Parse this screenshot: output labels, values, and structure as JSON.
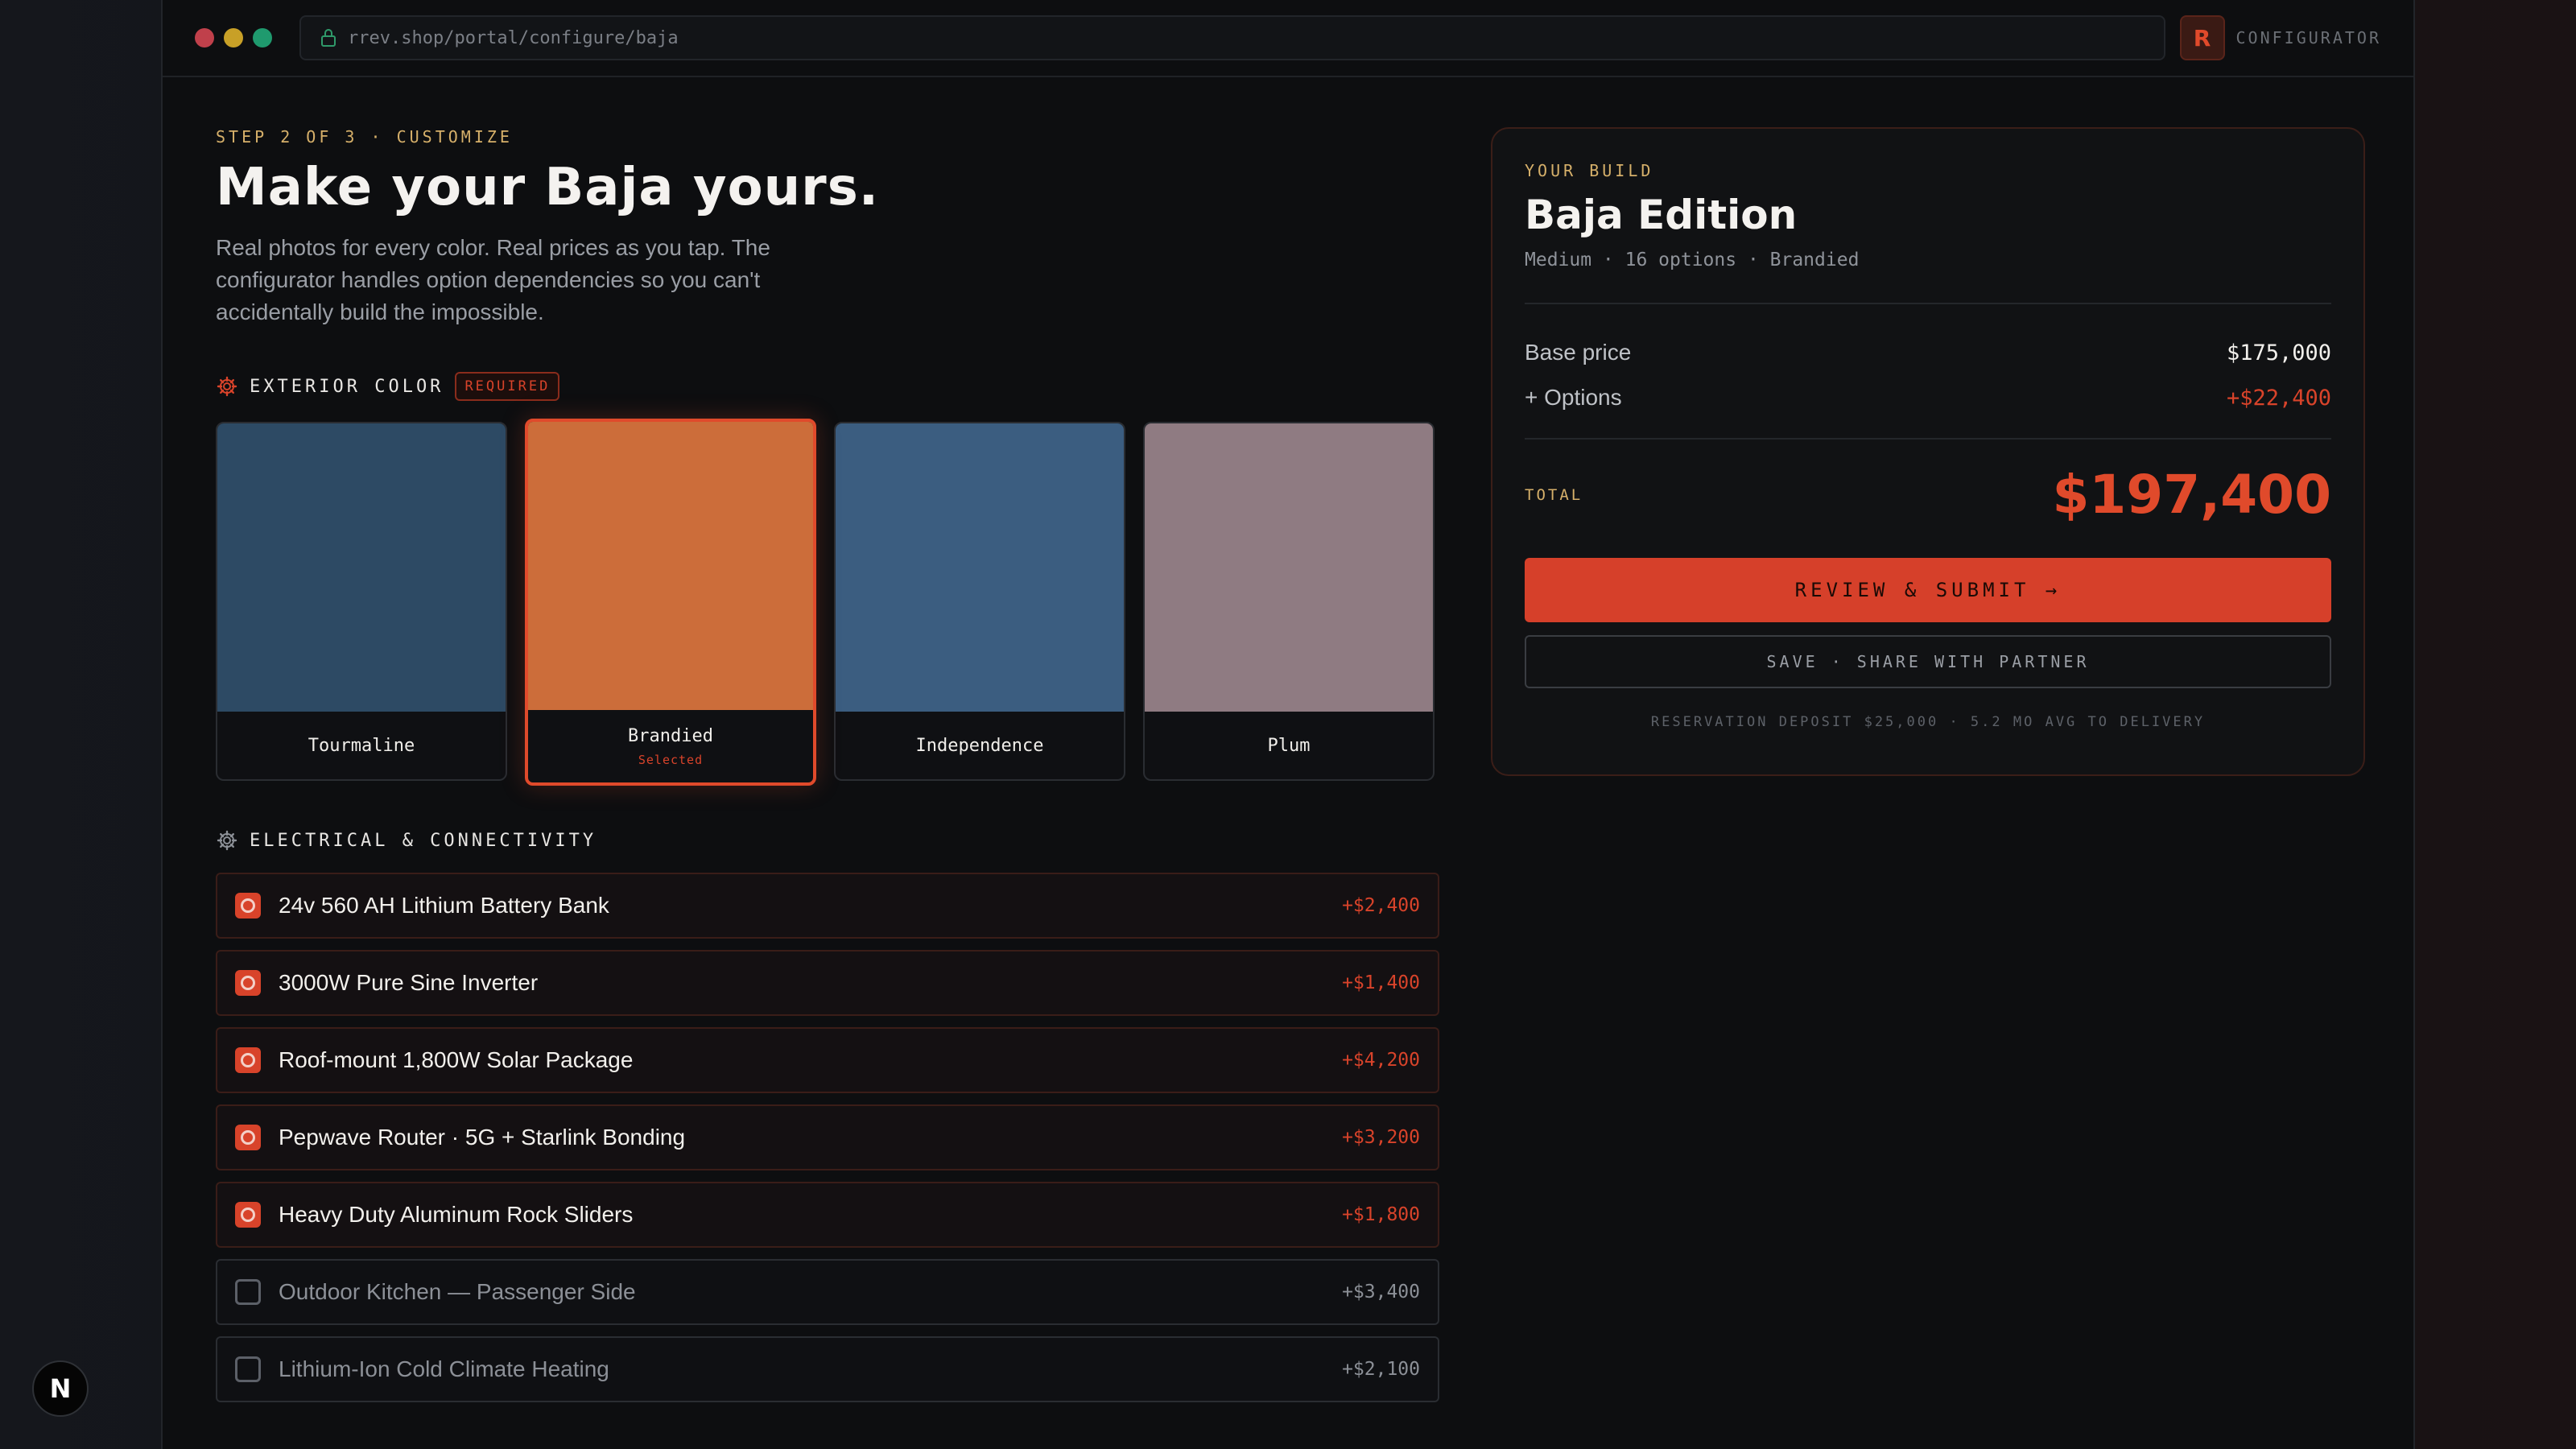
{
  "browser": {
    "url": "rrev.shop/portal/configure/baja",
    "brand_letter": "R",
    "brand_label": "CONFIGURATOR",
    "dot_colors": [
      "#c0404b",
      "#c8a027",
      "#1f9a6e"
    ]
  },
  "hero": {
    "step": "STEP 2 OF 3 · CUSTOMIZE",
    "title": "Make your Baja yours.",
    "description": "Real photos for every color. Real prices as you tap. The configurator handles option dependencies so you can't accidentally build the impossible."
  },
  "exterior": {
    "heading": "EXTERIOR COLOR",
    "badge": "REQUIRED",
    "swatches": [
      {
        "name": "Tourmaline",
        "color": "#2d4a64",
        "selected": false,
        "sub": ""
      },
      {
        "name": "Brandied",
        "color": "#cc6d3a",
        "selected": true,
        "sub": "Selected"
      },
      {
        "name": "Independence",
        "color": "#3b5d80",
        "selected": false,
        "sub": ""
      },
      {
        "name": "Plum",
        "color": "#8f7b82",
        "selected": false,
        "sub": ""
      }
    ]
  },
  "electrical": {
    "heading": "ELECTRICAL & CONNECTIVITY",
    "options": [
      {
        "name": "24v 560 AH Lithium Battery Bank",
        "price": "+$2,400",
        "checked": true
      },
      {
        "name": "3000W Pure Sine Inverter",
        "price": "+$1,400",
        "checked": true
      },
      {
        "name": "Roof-mount 1,800W Solar Package",
        "price": "+$4,200",
        "checked": true
      },
      {
        "name": "Pepwave Router · 5G + Starlink Bonding",
        "price": "+$3,200",
        "checked": true
      },
      {
        "name": "Heavy Duty Aluminum Rock Sliders",
        "price": "+$1,800",
        "checked": true
      },
      {
        "name": "Outdoor Kitchen — Passenger Side",
        "price": "+$3,400",
        "checked": false
      },
      {
        "name": "Lithium-Ion Cold Climate Heating",
        "price": "+$2,100",
        "checked": false
      }
    ]
  },
  "summary": {
    "eyebrow": "YOUR BUILD",
    "title": "Baja Edition",
    "meta": "Medium · 16 options · Brandied",
    "base_label": "Base price",
    "base_value": "$175,000",
    "options_label": "+ Options",
    "options_value": "+$22,400",
    "total_label": "TOTAL",
    "total_value": "$197,400",
    "primary_button": "REVIEW & SUBMIT →",
    "secondary_button": "SAVE · SHARE WITH PARTNER",
    "footnote": "RESERVATION DEPOSIT $25,000 · 5.2 MO AVG TO DELIVERY"
  },
  "badge_letter": "N",
  "accent": "#d8432a"
}
